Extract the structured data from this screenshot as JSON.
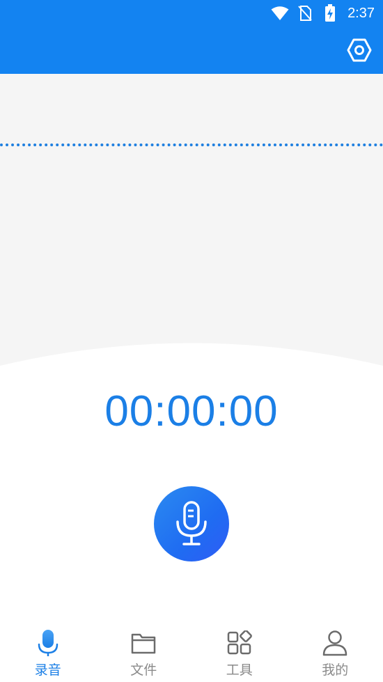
{
  "status_bar": {
    "time": "2:37",
    "icons": [
      "wifi-icon",
      "no-sim-icon",
      "battery-charging-icon"
    ]
  },
  "app_bar": {
    "settings_icon": "settings-hex-icon"
  },
  "recorder": {
    "timer": "00:00:00",
    "record_icon": "microphone-icon"
  },
  "bottom_nav": {
    "items": [
      {
        "label": "录音",
        "icon": "microphone-icon",
        "active": true
      },
      {
        "label": "文件",
        "icon": "folder-icon",
        "active": false
      },
      {
        "label": "工具",
        "icon": "tools-grid-icon",
        "active": false
      },
      {
        "label": "我的",
        "icon": "person-icon",
        "active": false
      }
    ]
  },
  "colors": {
    "primary": "#1383f1",
    "accent_text": "#1b7fe6",
    "inactive_text": "#8a8a8a",
    "wave_bg": "#f5f5f5"
  }
}
